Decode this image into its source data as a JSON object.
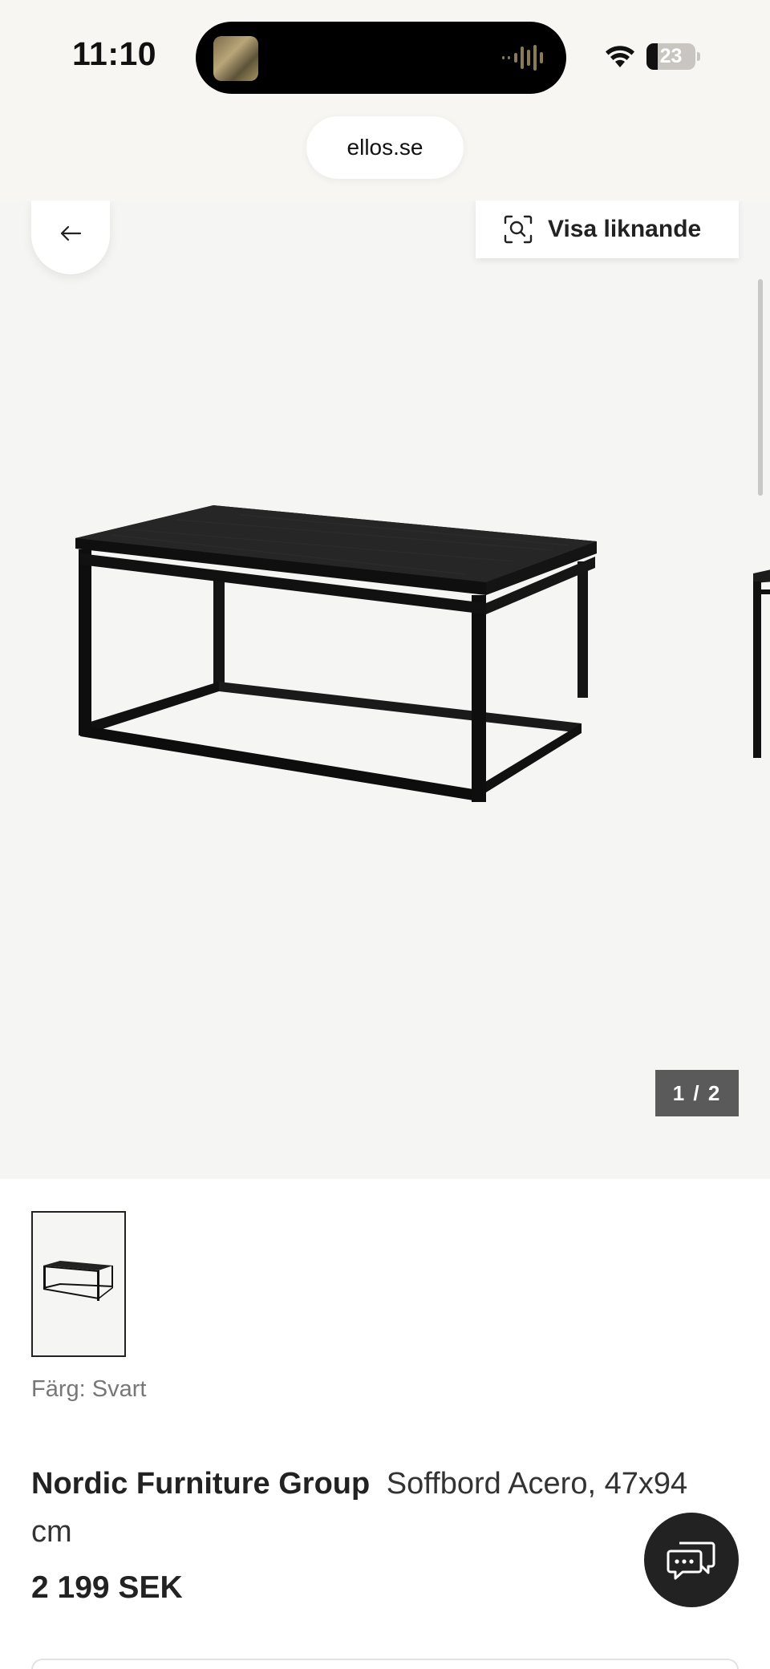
{
  "status_bar": {
    "time": "11:10",
    "battery_level": 23,
    "battery_text": "23",
    "icons": [
      "wifi-icon",
      "battery-icon",
      "audio-waveform-icon"
    ]
  },
  "browser": {
    "url": "ellos.se"
  },
  "gallery": {
    "back_icon": "arrow-left-icon",
    "visa_icon": "visual-search-icon",
    "visa_label": "Visa liknande",
    "counter": "1 / 2",
    "current_image": 1,
    "total_images": 2
  },
  "product": {
    "color_label": "Färg: Svart",
    "brand": "Nordic Furniture Group",
    "name": "Soffbord Acero, 47x94 cm",
    "price": "2 199 SEK"
  },
  "chat": {
    "icon": "chat-bubbles-icon"
  },
  "colors": {
    "background": "#f8f6f3",
    "gallery_bg": "#f5f5f4",
    "text": "#222222",
    "counter_bg": "#5a5a5a",
    "chat_bg": "#222222"
  }
}
